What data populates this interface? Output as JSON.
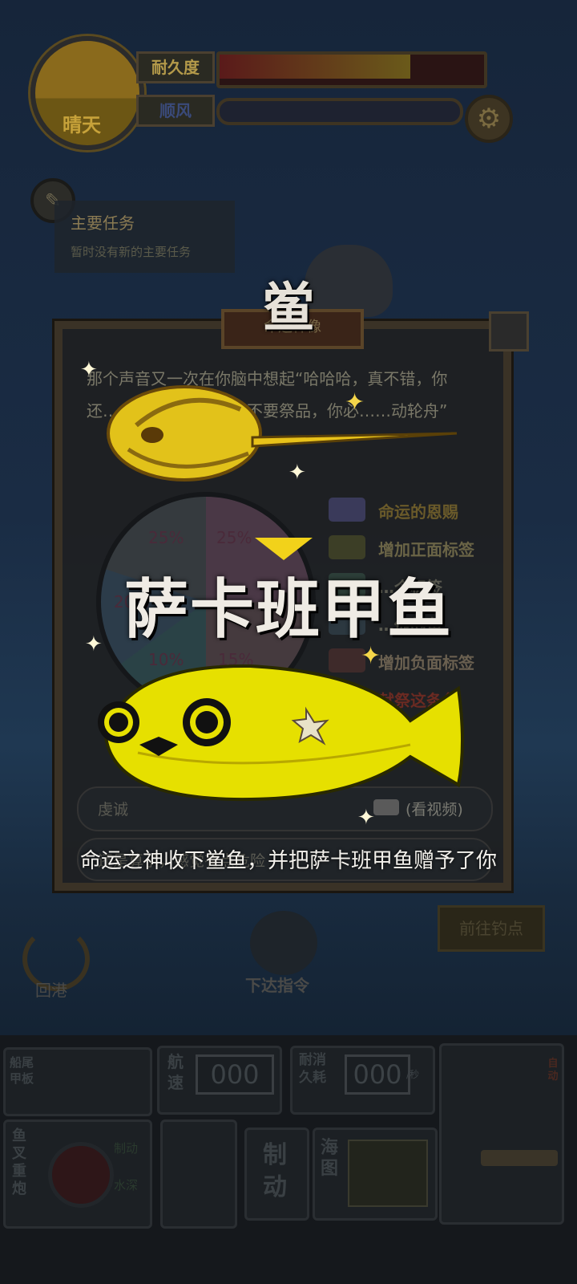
{
  "hud": {
    "weather_label": "晴天",
    "durability_label": "耐久度",
    "durability_level": 0.72,
    "wind_label": "顺风",
    "settings_icon": "gear-icon",
    "compass_icon": "compass-icon"
  },
  "quest": {
    "title": "主要任务",
    "subtitle": "暂时没有新的主要任务"
  },
  "dialog": {
    "title": "命运神像",
    "story": "那个声音又一次在你脑中想起“哈哈哈，真不错，你还……次献祭，这次我不要祭品，你必……动轮舟”",
    "wheel": {
      "labels": [
        "25%",
        "25%",
        "20%",
        "10%",
        "15%"
      ]
    },
    "legend": [
      {
        "text": "命运的恩赐",
        "swatch": "#3a3a5a",
        "color": "#6a5a2a"
      },
      {
        "text": "增加正面标签",
        "swatch": "#3c3e26",
        "color": "#6a6446"
      },
      {
        "text": "…个标签",
        "swatch": "#2c3e38",
        "color": "#5a5a50"
      },
      {
        "text": "…他的鱼",
        "swatch": "#2c3840",
        "color": "#5a5a50"
      },
      {
        "text": "增加负面标签",
        "swatch": "#3e2a2a",
        "color": "#6a6050"
      },
      {
        "text": "献祭这条鱼",
        "swatch": "#3a2a3a",
        "color": "#6a2a22"
      }
    ],
    "button_primary": "虔诚",
    "button_primary_hint": "(看视频)",
    "button_secondary": "还是算了，感觉有点危险"
  },
  "overlay": {
    "given_fish": "鲎",
    "received_fish": "萨卡班甲鱼",
    "message": "命运之神收下鲎鱼，并把萨卡班甲鱼赠予了你"
  },
  "actions": {
    "return_port": "回港",
    "command": "下达指令",
    "go_fish": "前往钓点"
  },
  "console": {
    "rear_deck": "船尾甲板",
    "speed_label": "航速",
    "speed_value": "000",
    "consumption_label": "耐消久耗",
    "consumption_value": "000",
    "consumption_unit": "/秒",
    "brake_label": "制动",
    "map_label": "海图",
    "harpoon_label": "鱼叉重炮",
    "brake_small": "制动",
    "water_small": "水深",
    "auto_label": "自动"
  },
  "colors": {
    "fish_yellow": "#e8e000",
    "gold": "#e8c21a"
  }
}
